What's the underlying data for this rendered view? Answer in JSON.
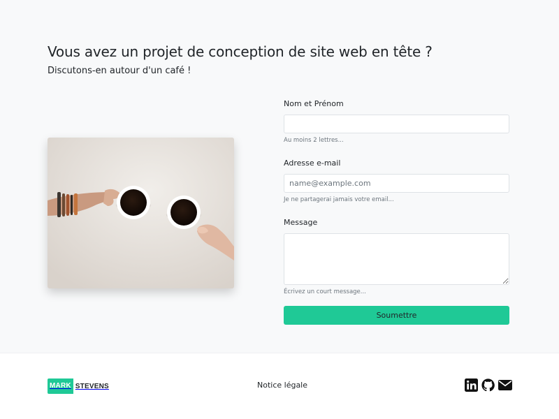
{
  "hero": {
    "title": "Vous avez un projet de conception de site web en tête ?",
    "subtitle": "Discutons-en autour d'un café !"
  },
  "photo": {
    "alt": "two-coffee-cups-photo"
  },
  "form": {
    "name": {
      "label": "Nom et Prénom",
      "value": "",
      "placeholder": "",
      "help": "Au moins 2 lettres..."
    },
    "email": {
      "label": "Adresse e-mail",
      "value": "",
      "placeholder": "name@example.com",
      "help": "Je ne partagerai jamais votre email..."
    },
    "message": {
      "label": "Message",
      "value": "",
      "placeholder": "",
      "help": "Écrivez un court message..."
    },
    "submit_label": "Soumettre"
  },
  "footer": {
    "logo_part1": "MARK",
    "logo_part2": "STEVENS",
    "legal_link": "Notice légale",
    "social_icons": [
      "linkedin-icon",
      "github-icon",
      "mail-icon"
    ]
  },
  "colors": {
    "accent": "#1fc996",
    "background": "#f8f9fa",
    "footer_bg": "#ffffff",
    "text": "#212529",
    "muted": "#6c757d"
  }
}
